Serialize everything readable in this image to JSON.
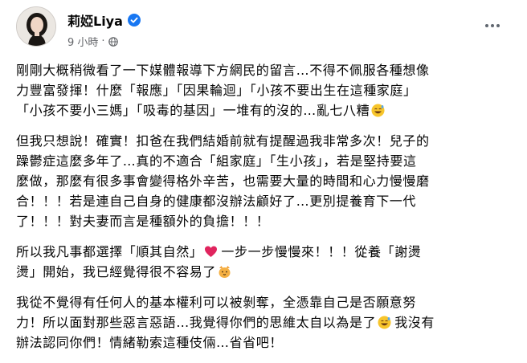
{
  "author": {
    "name": "莉婭Liya",
    "verified_icon": "verified-badge-icon"
  },
  "meta": {
    "time": "9 小時",
    "separator": "·",
    "audience_icon": "globe-icon"
  },
  "more_icon": "more-options-icon",
  "body": {
    "p1": [
      "剛剛大概稍微看了一下媒體報導下方網民的留言…不得不佩服各種想像",
      "力豐富發揮！什麼「報應」「因果輪迴」「小孩不要出生在這種家庭」",
      "「小孩不要小三媽」「吸毒的基因」一堆有的沒的…亂七八糟"
    ],
    "p2": [
      "但我只想說！確實！扣爸在我們結婚前就有提醒過我非常多次！兒子的",
      "躁鬱症這麼多年了…真的不適合「組家庭」「生小孩」，若是堅持要這",
      "麼做，那麼有很多事會變得格外辛苦，也需要大量的時間和心力慢慢磨",
      "合！！！若是連自己自身的健康都沒辦法顧好了…更別提養育下一代",
      "了！！！對夫妻而言是種額外的負擔！！！"
    ],
    "p3": [
      "所以我凡事都選擇「順其自然」",
      "一步一步慢慢來！！！從養「謝燙",
      "燙」開始，我已經覺得很不容易了"
    ],
    "p4": [
      "我從不覺得有任何人的基本權利可以被剝奪，全憑靠自己是否願意努",
      "力！所以面對那些惡言惡語…我覺得你們的思維太自以為是了",
      "我沒有",
      "辦法認同你們！情緒勒索這種伎倆…省省吧！"
    ]
  },
  "emojis": {
    "laugh": "grinning-sweat-emoji",
    "heart": "red-heart-emoji",
    "cat": "cat-face-emoji"
  },
  "colors": {
    "text": "#050505",
    "meta": "#65676b",
    "verified": "#1877f2",
    "heart": "#e0245e",
    "emoji": "#f7c52b"
  }
}
